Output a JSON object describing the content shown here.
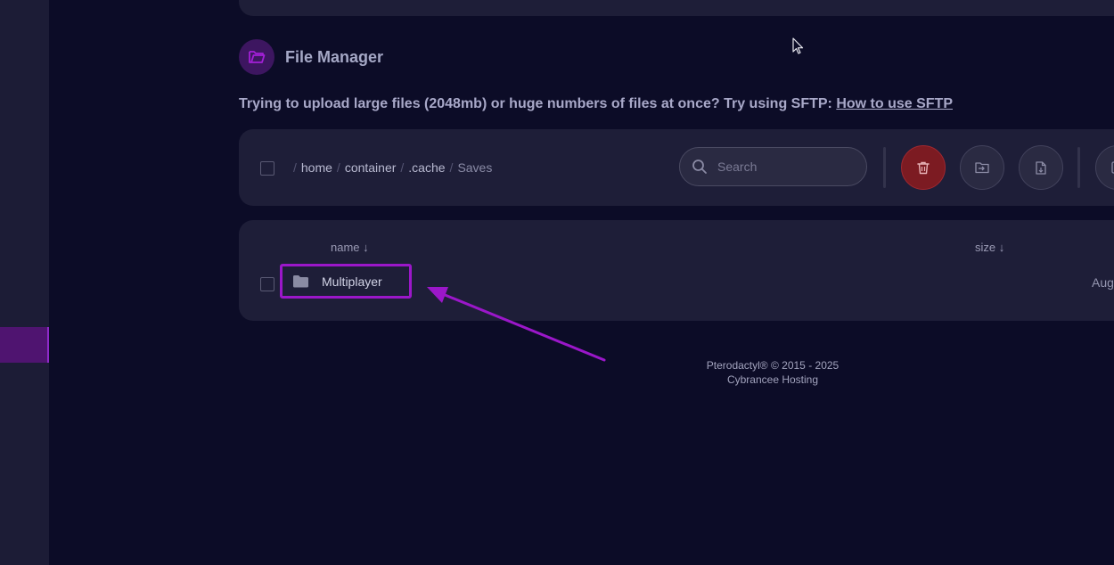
{
  "header": {
    "title": "File Manager",
    "icon": "folder-open-icon",
    "accent": "#9b17c9"
  },
  "notice": {
    "text": "Trying to upload large files (2048mb) or huge numbers of files at once? Try using SFTP: ",
    "link": "How to use SFTP"
  },
  "breadcrumb": {
    "segments": [
      "home",
      "container",
      ".cache",
      "Saves"
    ]
  },
  "search": {
    "placeholder": "Search",
    "value": ""
  },
  "toolbar": {
    "actions": [
      "trash-icon",
      "folder-import-icon",
      "file-import-icon"
    ]
  },
  "table": {
    "columns": {
      "name": "name ↓",
      "size": "size ↓"
    },
    "rows": [
      {
        "name": "Multiplayer",
        "type": "folder",
        "modified": "Aug"
      }
    ]
  },
  "footer": {
    "line1": "Pterodactyl® © 2015 - 2025",
    "line2": "Cybrancee Hosting"
  }
}
